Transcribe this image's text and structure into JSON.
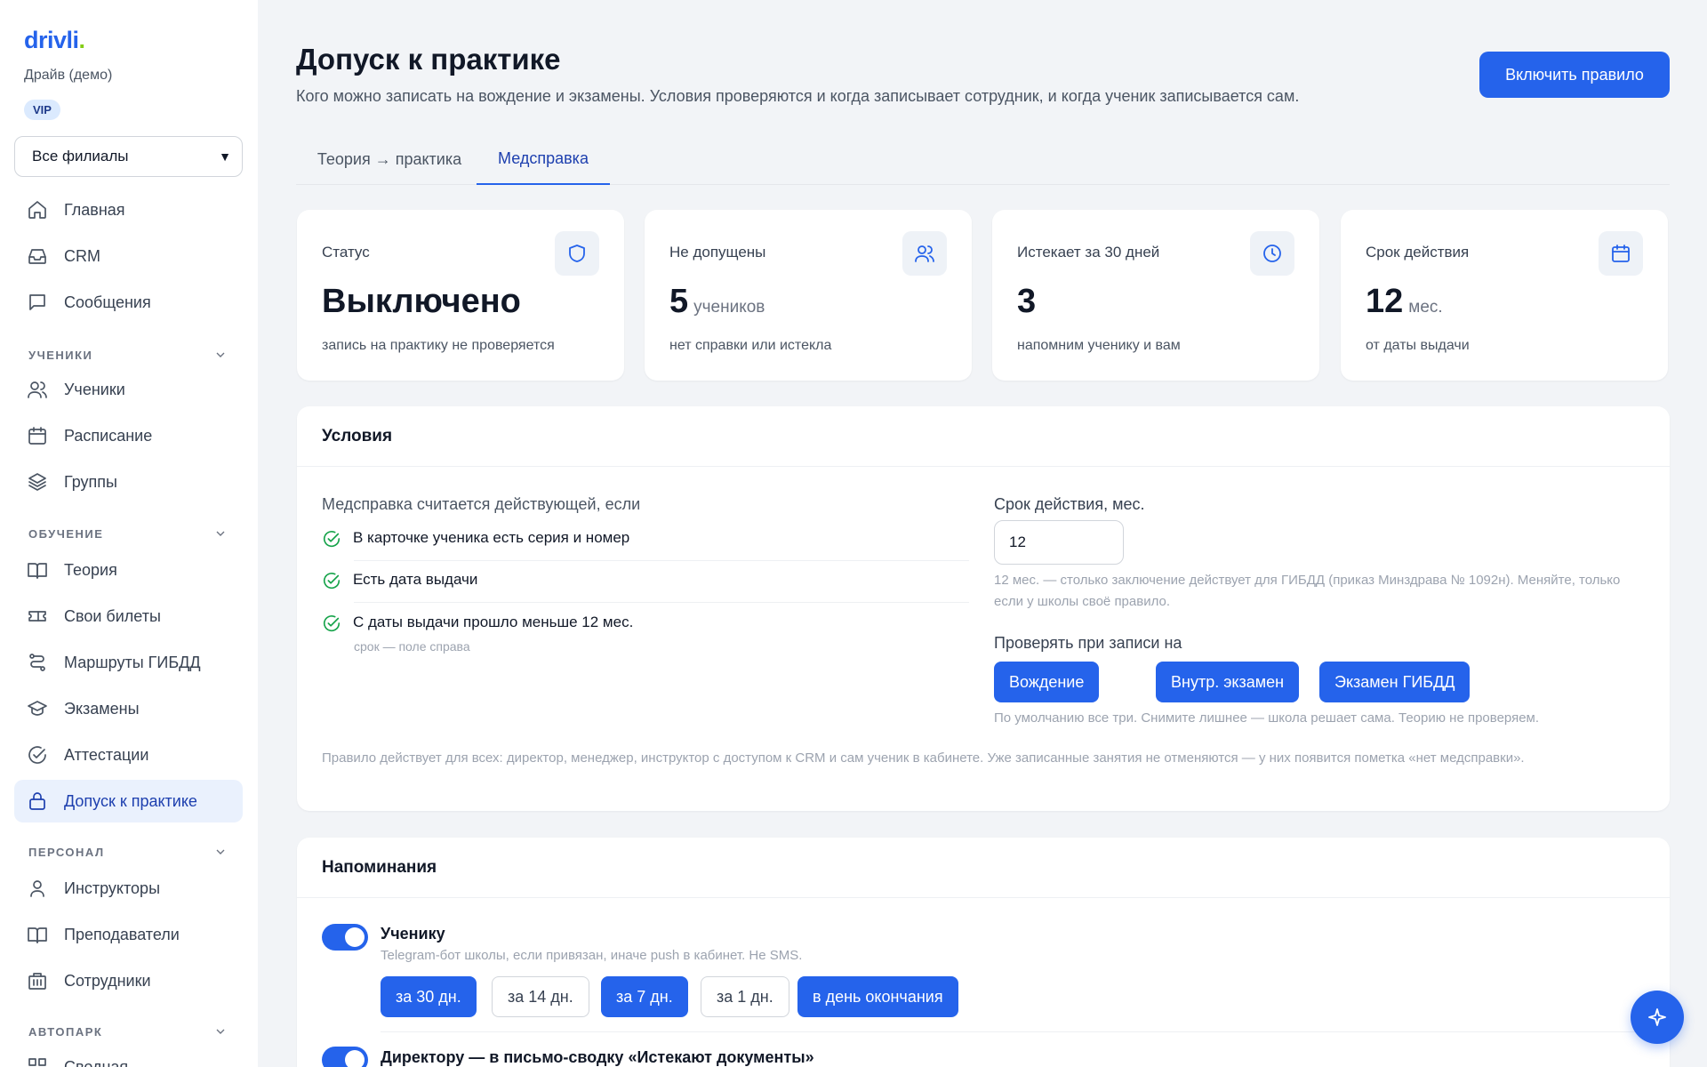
{
  "sidebar": {
    "logo": "drivli",
    "logo_dot": ".",
    "school": "Драйв (демо)",
    "badge": "VIP",
    "branch_select": "Все филиалы",
    "items": [
      {
        "label": "Главная",
        "icon": "home-icon"
      },
      {
        "label": "CRM",
        "icon": "inbox-icon"
      },
      {
        "label": "Сообщения",
        "icon": "message-icon"
      }
    ],
    "sections": [
      {
        "title": "УЧЕНИКИ",
        "items": [
          {
            "label": "Ученики"
          },
          {
            "label": "Расписание"
          },
          {
            "label": "Группы"
          }
        ]
      },
      {
        "title": "ОБУЧЕНИЕ",
        "items": [
          {
            "label": "Теория"
          },
          {
            "label": "Свои билеты"
          },
          {
            "label": "Маршруты ГИБДД"
          },
          {
            "label": "Экзамены"
          },
          {
            "label": "Аттестации"
          },
          {
            "label": "Допуск к практике"
          }
        ]
      },
      {
        "title": "ПЕРСОНАЛ",
        "items": [
          {
            "label": "Инструкторы"
          },
          {
            "label": "Преподаватели"
          },
          {
            "label": "Сотрудники"
          }
        ]
      },
      {
        "title": "АВТОПАРК",
        "items": [
          {
            "label": "Сводная"
          }
        ]
      }
    ]
  },
  "header": {
    "title": "Допуск к практике",
    "subtitle": "Кого можно записать на вождение и экзамены. Условия проверяются и когда записывает сотрудник, и когда ученик записывается сам.",
    "primary_action": "Включить правило"
  },
  "tabs": [
    {
      "label": "Теория → практика",
      "active": false
    },
    {
      "label": "Медсправка",
      "active": true
    }
  ],
  "stats": [
    {
      "label": "Статус",
      "value": "Выключено",
      "unit": "",
      "note": "запись на практику не проверяется",
      "icon": "shield-icon"
    },
    {
      "label": "Не допущены",
      "value": "5",
      "unit": "учеников",
      "note": "нет справки или истекла",
      "icon": "users-icon"
    },
    {
      "label": "Истекает за 30 дней",
      "value": "3",
      "unit": "",
      "note": "напомним ученику и вам",
      "icon": "clock-icon"
    },
    {
      "label": "Срок действия",
      "value": "12",
      "unit": "мес.",
      "note": "от даты выдачи",
      "icon": "calendar-icon"
    }
  ],
  "conditions": {
    "title": "Условия",
    "intro": "Медсправка считается действующей, если",
    "checks": [
      {
        "text": "В карточке ученика есть серия и номер"
      },
      {
        "text": "Есть дата выдачи"
      },
      {
        "text": "С даты выдачи прошло меньше 12 мес.",
        "hint": "срок — поле справа"
      }
    ],
    "validity_label": "Срок действия, мес.",
    "validity_value": "12",
    "validity_help": "12 мес. — столько заключение действует для ГИБДД (приказ Минздрава № 1092н). Меняйте, только если у школы своё правило.",
    "check_on_label": "Проверять при записи на",
    "check_on": [
      {
        "label": "Вождение",
        "selected": true
      },
      {
        "label": "Внутр. экзамен",
        "selected": true
      },
      {
        "label": "Экзамен ГИБДД",
        "selected": true
      }
    ],
    "check_on_help": "По умолчанию все три. Снимите лишнее — школа решает сама. Теорию не проверяем.",
    "rule_note": "Правило действует для всех: директор, менеджер, инструктор с доступом к CRM и сам ученик в кабинете. Уже записанные занятия не отменяются — у них появится пометка «нет медсправки»."
  },
  "reminders": {
    "title": "Напоминания",
    "student": {
      "enabled": true,
      "title": "Ученику",
      "subtitle": "Telegram-бот школы, если привязан, иначе push в кабинет. Не SMS.",
      "options": [
        {
          "label": "за 30 дн.",
          "selected": true
        },
        {
          "label": "за 14 дн.",
          "selected": false
        },
        {
          "label": "за 7 дн.",
          "selected": true
        },
        {
          "label": "за 1 дн.",
          "selected": false
        },
        {
          "label": "в день окончания",
          "selected": true
        }
      ]
    },
    "director": {
      "enabled": true,
      "title": "Директору — в письмо-сводку «Истекают документы»"
    }
  },
  "colors": {
    "accent": "#2563eb",
    "success": "#16a34a",
    "logo_dot": "#84cc16"
  }
}
